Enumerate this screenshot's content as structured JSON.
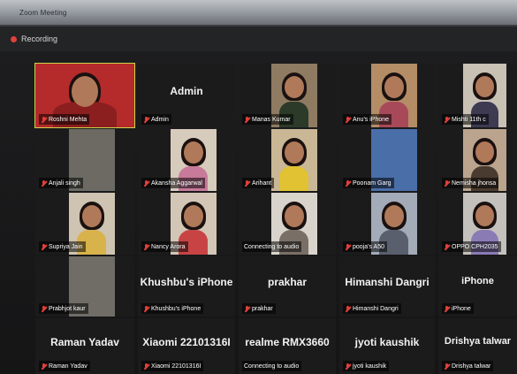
{
  "window": {
    "title": "Zoom Meeting"
  },
  "recording": {
    "label": "Recording"
  },
  "participants": [
    {
      "name": "Roshni Mehta",
      "big": "",
      "video": true,
      "active": true,
      "bg": "#b52a2a",
      "shirt": "#8b1e1e"
    },
    {
      "name": "Admin",
      "big": "Admin",
      "video": false
    },
    {
      "name": "Manas Kumar",
      "big": "",
      "video": true,
      "bg": "#8f7a62",
      "shirt": "#2c3a2a"
    },
    {
      "name": "Anu's iPhone",
      "big": "",
      "video": true,
      "bg": "#b48c66",
      "shirt": "#a8495a"
    },
    {
      "name": "Mishti 11th c",
      "big": "",
      "video": true,
      "bg": "#c8c1b4",
      "shirt": "#3d3a52"
    },
    {
      "name": "Anjali singh",
      "big": "",
      "video": true,
      "bg": "#6c6a63",
      "shirt": "#6c6a63",
      "nohead": true
    },
    {
      "name": "Akansha Aggarwal",
      "big": "",
      "video": true,
      "bg": "#d7cbbc",
      "shirt": "#c77a9a"
    },
    {
      "name": "Arihant",
      "big": "",
      "video": true,
      "bg": "#c9b795",
      "shirt": "#e0c232"
    },
    {
      "name": "Poonam Garg",
      "big": "",
      "video": true,
      "bg": "#4a6ea8",
      "shirt": "#3b5a8a",
      "nohead": true
    },
    {
      "name": "Nemisha jhonsa",
      "big": "",
      "video": true,
      "bg": "#bba48e",
      "shirt": "#4a3b30"
    },
    {
      "name": "Supriya Jain",
      "big": "",
      "video": true,
      "bg": "#cfc3b1",
      "shirt": "#d8b24a"
    },
    {
      "name": "Nancy Arora",
      "big": "",
      "video": true,
      "bg": "#d3c6b6",
      "shirt": "#c84444"
    },
    {
      "name": "Connecting to audio",
      "big": "",
      "video": true,
      "bg": "#d9d4cb",
      "shirt": "#7a6f66"
    },
    {
      "name": "pooja's A50",
      "big": "",
      "video": true,
      "bg": "#a3aab8",
      "shirt": "#5a5f6e"
    },
    {
      "name": "OPPO CPH2035",
      "big": "",
      "video": true,
      "bg": "#c4c0bb",
      "shirt": "#8a7bb5"
    },
    {
      "name": "Prabhjot kaur",
      "big": "",
      "video": true,
      "bg": "#6f6d66",
      "shirt": "#6f6d66",
      "nohead": true
    },
    {
      "name": "Khushbu's iPhone",
      "big": "Khushbu's iPhone",
      "video": false
    },
    {
      "name": "prakhar",
      "big": "prakhar",
      "video": false
    },
    {
      "name": "Himanshi Dangri",
      "big": "Himanshi Dangri",
      "video": false
    },
    {
      "name": "iPhone",
      "big": "iPhone",
      "video": false
    },
    {
      "name": "Raman Yadav",
      "big": "Raman Yadav",
      "video": false
    },
    {
      "name": "Xiaomi 22101316I",
      "big": "Xiaomi 22101316I",
      "video": false
    },
    {
      "name": "Connecting to audio",
      "big": "realme RMX3660",
      "video": false
    },
    {
      "name": "jyoti kaushik",
      "big": "jyoti kaushik",
      "video": false
    },
    {
      "name": "Drishya talwar",
      "big": "Drishya talwar",
      "video": false
    }
  ]
}
